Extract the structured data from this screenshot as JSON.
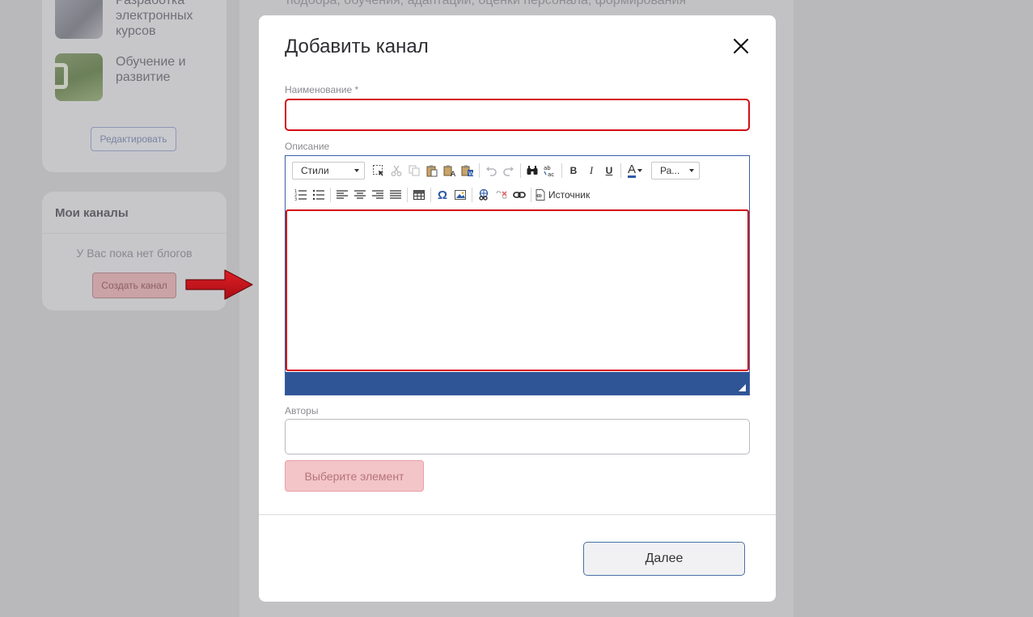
{
  "background": {
    "top_text": "подбора, обучения, адаптации, оценки персонала, формирования",
    "courses": [
      {
        "title": "Разработка электронных курсов",
        "icon": "laptop-thumbnail-icon"
      },
      {
        "title": "Обучение и развитие",
        "icon": "meadow-thumbnail-icon"
      }
    ],
    "edit_label": "Редактировать",
    "my_channels": {
      "title": "Мои каналы",
      "empty_text": "У Вас пока нет блогов",
      "create_label": "Создать канал"
    }
  },
  "modal": {
    "title": "Добавить канал",
    "name_label": "Наименование *",
    "name_value": "",
    "description_label": "Описание",
    "toolbar": {
      "styles_label": "Стили",
      "size_label": "Ра...",
      "bold": "B",
      "italic": "I",
      "underline": "U",
      "text_color": "A",
      "source_label": "Источник"
    },
    "authors_label": "Авторы",
    "authors_value": "",
    "select_label": "Выберите элемент",
    "next_label": "Далее"
  },
  "colors": {
    "error_border": "#d40d14",
    "editor_statusbar": "#2f5596",
    "arrow": "#c8141c",
    "select_button": "#f3c4c8"
  }
}
